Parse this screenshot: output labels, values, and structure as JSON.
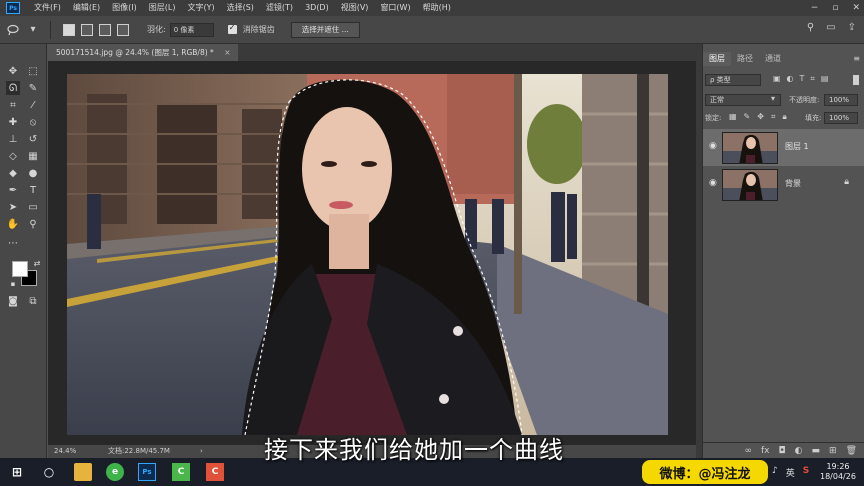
{
  "menubar": {
    "logo": "Ps",
    "items": [
      "文件(F)",
      "编辑(E)",
      "图像(I)",
      "图层(L)",
      "文字(Y)",
      "选择(S)",
      "滤镜(T)",
      "3D(D)",
      "视图(V)",
      "窗口(W)",
      "帮助(H)"
    ],
    "win_controls": [
      "−",
      "▫",
      "✕"
    ]
  },
  "optbar": {
    "feather_label": "羽化:",
    "feather_value": "0 像素",
    "antialias_label": "消除锯齿",
    "select_mask_button": "选择并遮住 ..."
  },
  "document": {
    "tab_title": "500171514.jpg @ 24.4% (图层 1, RGB/8) *",
    "tab_close": "×",
    "zoom": "24.4%",
    "doc_size": "文档:22.8M/45.7M"
  },
  "subtitle": "接下来我们给她加一个曲线",
  "layers_panel": {
    "tabs": [
      "图层",
      "路径",
      "通道"
    ],
    "filter_kind": "ρ 类型",
    "blend_mode": "正常",
    "opacity_label": "不透明度:",
    "opacity_value": "100%",
    "lock_label": "锁定:",
    "fill_label": "填充:",
    "fill_value": "100%",
    "layers": [
      {
        "name": "图层 1",
        "visible": true,
        "selected": true,
        "locked": false
      },
      {
        "name": "背景",
        "visible": true,
        "selected": false,
        "locked": true
      }
    ],
    "footer_icons": [
      "link-icon",
      "fx-icon",
      "mask-icon",
      "adjustment-icon",
      "group-icon",
      "new-layer-icon",
      "trash-icon"
    ],
    "fx_label": "fx"
  },
  "taskbar": {
    "weibo_text": "微博：@冯注龙",
    "tray_lang": "英",
    "time": "19:26",
    "date": "18/04/26"
  }
}
